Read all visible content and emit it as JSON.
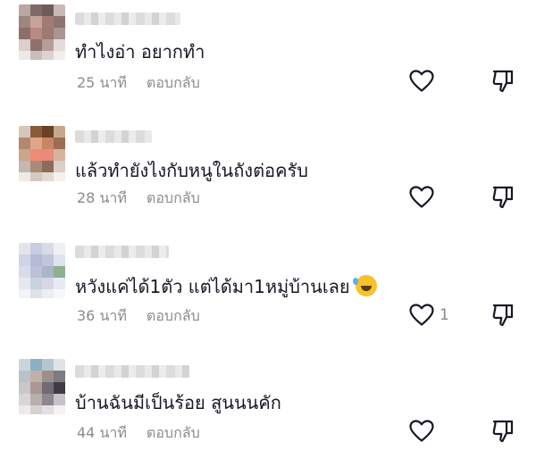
{
  "comments": [
    {
      "text": "ทำไงอ่า อยากทำ",
      "time": "25 นาที",
      "reply": "ตอบกลับ",
      "likes": ""
    },
    {
      "text": "แล้วทำยังไงกับหนูในถังต่อครับ",
      "time": "28 นาที",
      "reply": "ตอบกลับ",
      "likes": ""
    },
    {
      "text": "หวังแค่ได้1ตัว แต่ได้มา1หมู่บ้านเลย",
      "time": "36 นาที",
      "reply": "ตอบกลับ",
      "likes": "1"
    },
    {
      "text": "บ้านฉันมีเป็นร้อย สูนนนคัก",
      "time": "44 นาที",
      "reply": "ตอบกลับ",
      "likes": ""
    }
  ],
  "icons": {
    "like": "heart-outline-icon",
    "dislike": "thumbs-down-icon",
    "emoji": "rolling-on-floor-laughing-emoji"
  },
  "colors": {
    "text": "#161823",
    "meta": "#8a8b91",
    "icon": "#161823"
  }
}
